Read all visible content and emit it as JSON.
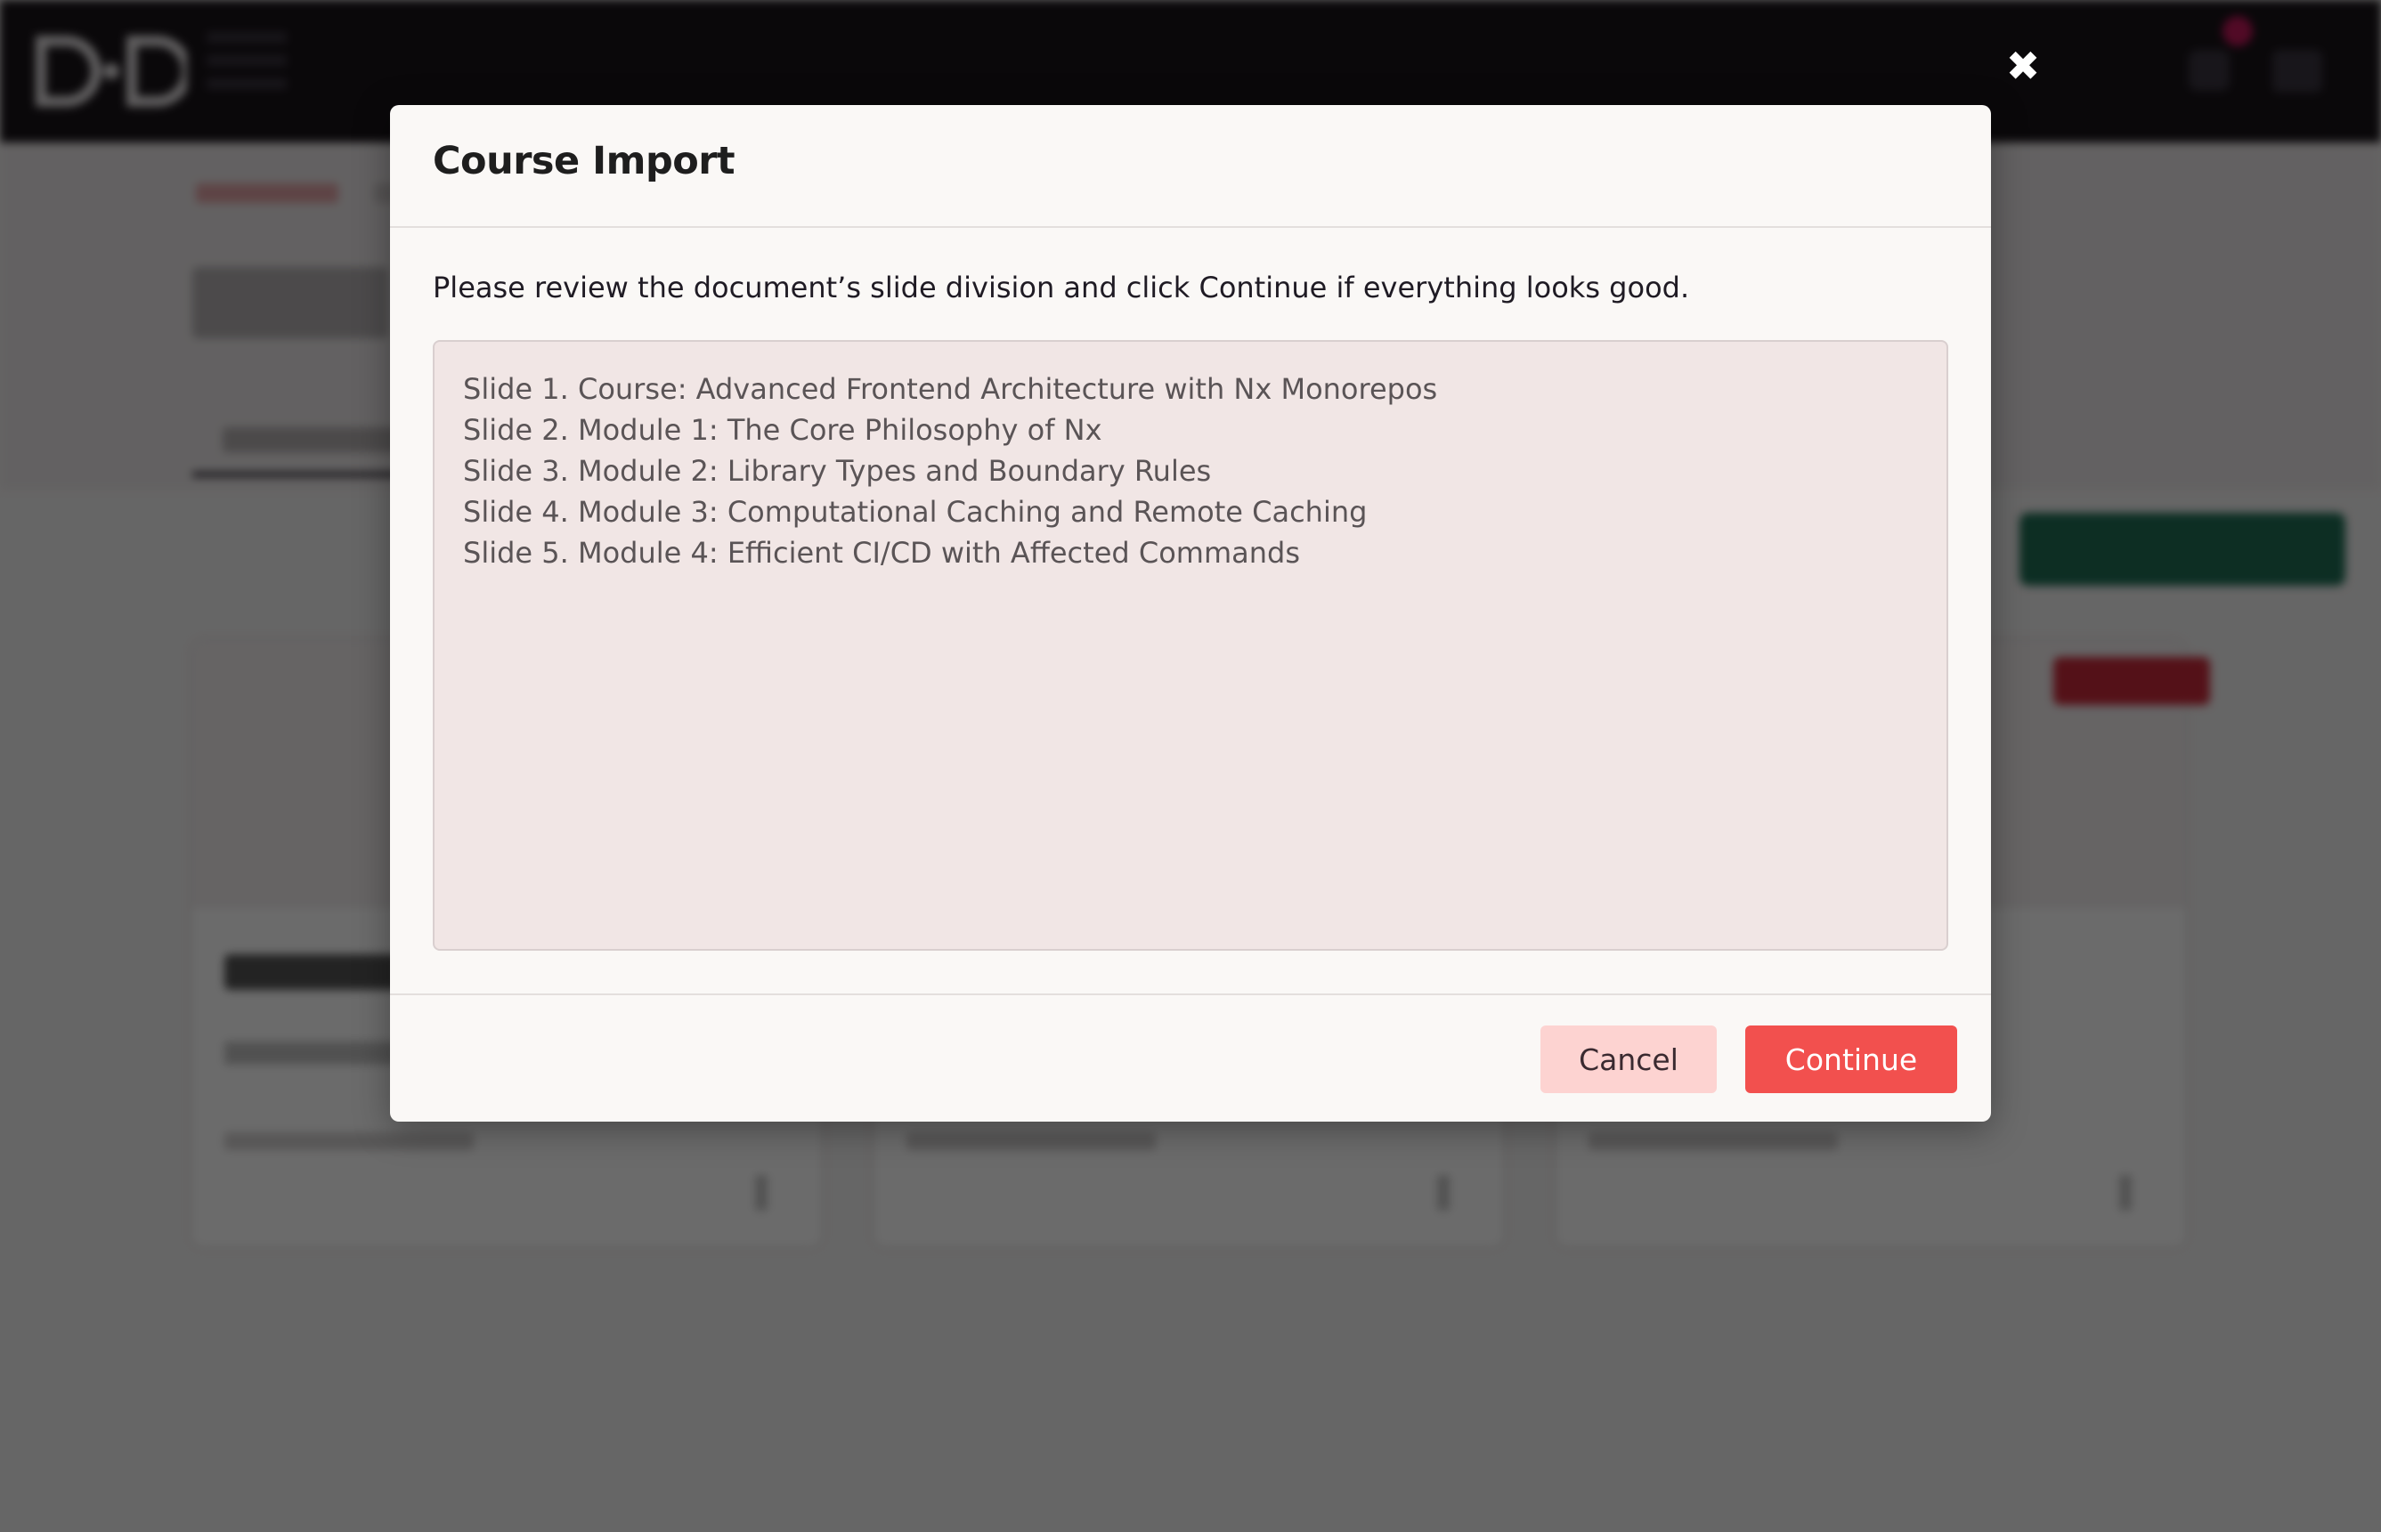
{
  "modal": {
    "title": "Course Import",
    "close_icon": "close-icon",
    "description": "Please review the document’s slide division and click Continue if everything looks good.",
    "slides": [
      "Slide 1. Course: Advanced Frontend Architecture with Nx Monorepos",
      "Slide 2. Module 1: The Core Philosophy of Nx",
      "Slide 3. Module 2: Library Types and Boundary Rules",
      "Slide 4. Module 3: Computational Caching and Remote Caching",
      "Slide 5. Module 4: Efficient CI/CD with Affected Commands"
    ],
    "cancel_label": "Cancel",
    "continue_label": "Continue"
  },
  "colors": {
    "overlay": "#000000",
    "continue_button": "#f2504e",
    "cancel_button": "#fdd3d1",
    "slides_box": "#f1e6e5"
  }
}
